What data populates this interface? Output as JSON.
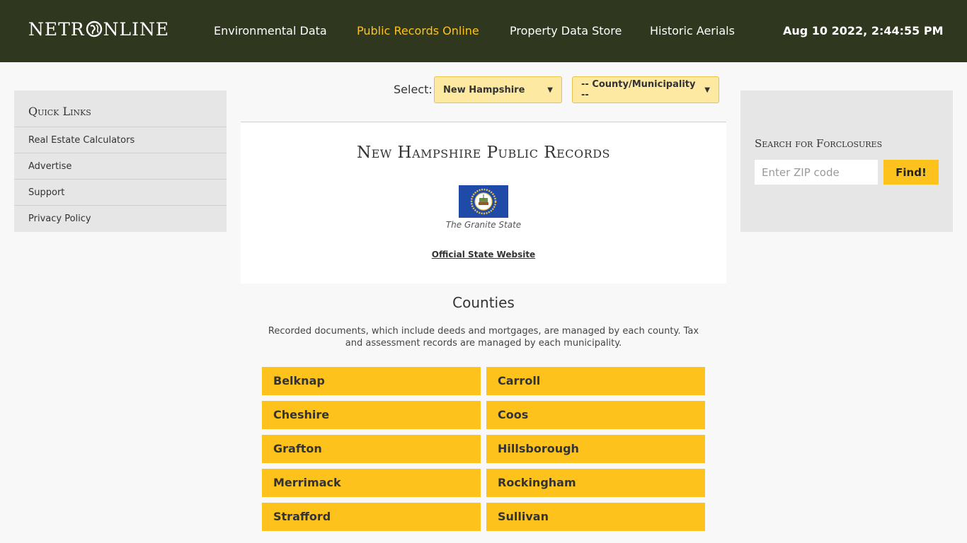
{
  "header": {
    "logo": {
      "part1": "NETR",
      "part2": "NLINE"
    },
    "nav": [
      {
        "label": "Environmental Data"
      },
      {
        "label": "Public Records Online"
      },
      {
        "label": "Property Data Store"
      },
      {
        "label": "Historic Aerials"
      }
    ],
    "clock": "Aug 10 2022, 2:44:55 PM"
  },
  "quick_links": {
    "title": "Quick Links",
    "items": [
      "Real Estate Calculators",
      "Advertise",
      "Support",
      "Privacy Policy"
    ]
  },
  "selector": {
    "label": "Select:",
    "state": "New Hampshire",
    "county": "-- County/Municipality --"
  },
  "state_card": {
    "title": "New Hampshire Public Records",
    "nickname": "The Granite State",
    "official_link": "Official State Website"
  },
  "counties": {
    "title": "Counties",
    "description": "Recorded documents, which include deeds and mortgages, are managed by each county. Tax and assessment records are managed by each municipality.",
    "items": [
      "Belknap",
      "Carroll",
      "Cheshire",
      "Coos",
      "Grafton",
      "Hillsborough",
      "Merrimack",
      "Rockingham",
      "Strafford",
      "Sullivan"
    ]
  },
  "foreclosures": {
    "title": "Search for Forclosures",
    "zip_placeholder": "Enter ZIP code",
    "button": "Find!"
  },
  "colors": {
    "header_bg": "#2f371e",
    "accent": "#fdc31c",
    "panel_bg": "#e6e6e6",
    "flag_blue": "#1f4aa8"
  }
}
